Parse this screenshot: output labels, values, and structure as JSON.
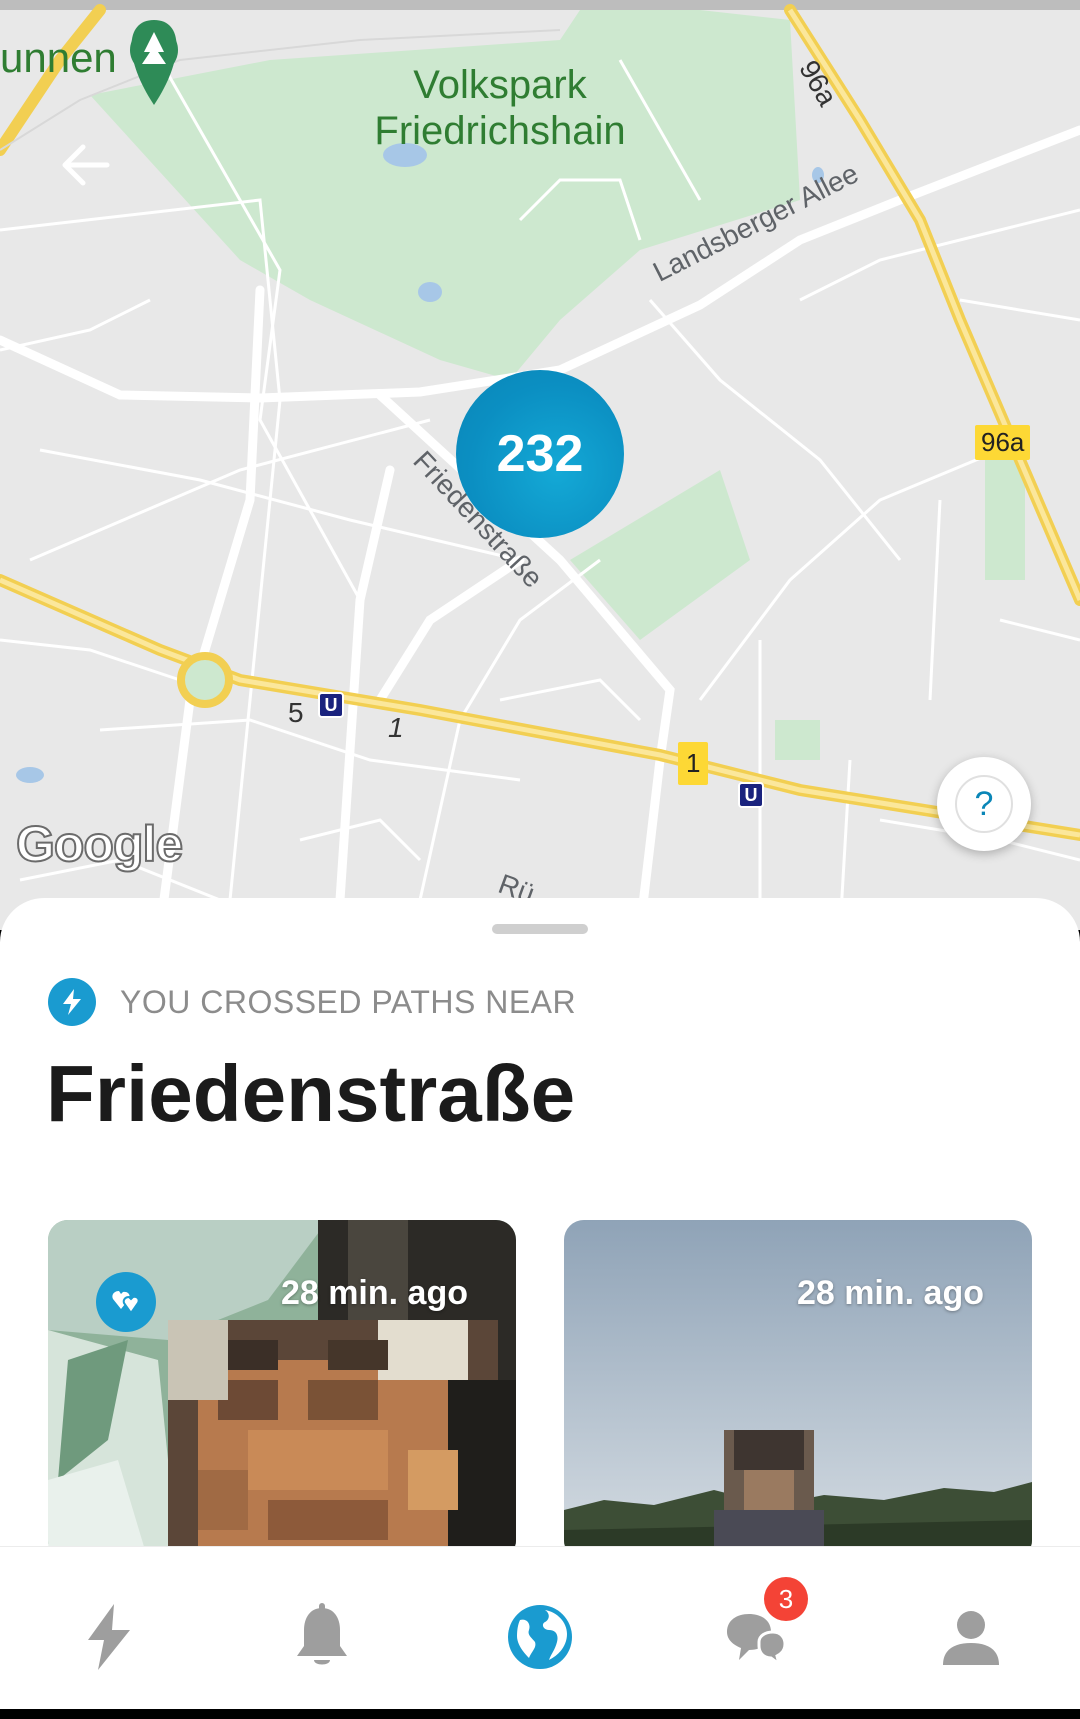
{
  "map": {
    "park_label_line1": "Volkspark",
    "park_label_line2": "Friedrichshain",
    "partial_label": "unnen",
    "road_landsberger": "Landsberger Allee",
    "road_friedenstrasse": "Friedenstraße",
    "road_partial_bottom": "Rü",
    "route_96a_rotated": "96a",
    "route_96a_shield": "96a",
    "route_1_shield": "1",
    "route_1_label": "1",
    "route_5_label": "5",
    "ubahn_label": "U",
    "cluster_count": "232",
    "google_logo": "Google",
    "help_label": "?"
  },
  "sheet": {
    "crossed_label": "YOU CROSSED PATHS NEAR",
    "place_title": "Friedenstraße"
  },
  "cards": [
    {
      "time": "28 min. ago",
      "has_heart_badge": true
    },
    {
      "time": "28 min. ago",
      "has_heart_badge": false
    }
  ],
  "nav": {
    "items": [
      "bolt-icon",
      "bell-icon",
      "globe-icon",
      "chat-icon",
      "profile-icon"
    ],
    "active": "globe-icon",
    "chat_badge": "3"
  },
  "colors": {
    "accent": "#1a9bd0",
    "cluster": "#0b8fc2",
    "badge": "#f44336",
    "park": "#c8e6c9",
    "highway": "#fdd835"
  }
}
